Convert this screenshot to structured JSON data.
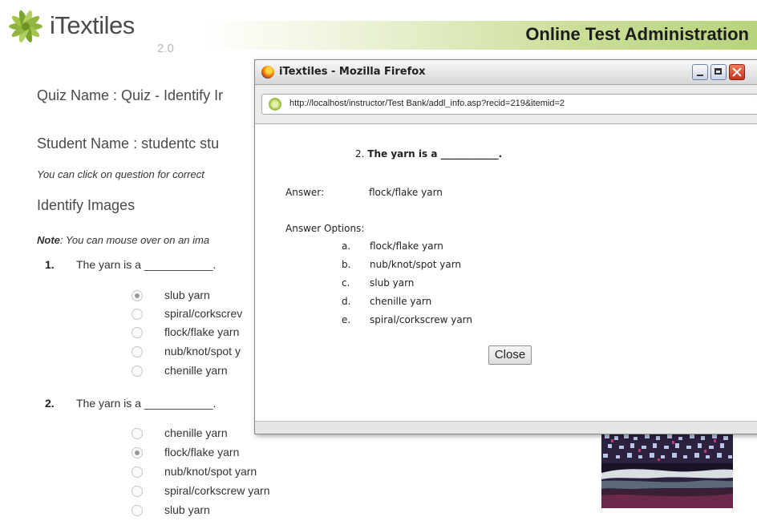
{
  "header": {
    "logo_text": "iTextiles",
    "logo_version": "2.0",
    "title": "Online Test Administration"
  },
  "quiz": {
    "name_line": "Quiz Name : Quiz - Identify Ir",
    "student_line": "Student Name : studentc stu",
    "hint": "You can click on question for correct",
    "section_title": "Identify Images",
    "note_label": "Note",
    "note_text": ": You can mouse over on an ima",
    "questions": [
      {
        "number": "1.",
        "text": "The yarn is a ___________.",
        "options": [
          {
            "label": "slub yarn",
            "selected": true
          },
          {
            "label": "spiral/corkscrev",
            "selected": false
          },
          {
            "label": "flock/flake yarn",
            "selected": false
          },
          {
            "label": "nub/knot/spot y",
            "selected": false
          },
          {
            "label": "chenille yarn",
            "selected": false
          }
        ]
      },
      {
        "number": "2.",
        "text": "The yarn is a ___________.",
        "options": [
          {
            "label": "chenille yarn",
            "selected": false
          },
          {
            "label": "flock/flake yarn",
            "selected": true
          },
          {
            "label": "nub/knot/spot yarn",
            "selected": false
          },
          {
            "label": "spiral/corkscrew yarn",
            "selected": false
          },
          {
            "label": "slub yarn",
            "selected": false
          }
        ]
      }
    ]
  },
  "popup": {
    "window_title": "iTextiles - Mozilla Firefox",
    "url": "http://localhost/instructor/Test Bank/addl_info.asp?recid=219&itemid=2",
    "question_number": "2.",
    "question_text": "The yarn is a ____________.",
    "answer_label": "Answer:",
    "answer_value": "flock/flake yarn",
    "options_label": "Answer Options:",
    "options": [
      {
        "letter": "a.",
        "text": "flock/flake yarn"
      },
      {
        "letter": "b.",
        "text": "nub/knot/spot yarn"
      },
      {
        "letter": "c.",
        "text": "slub yarn"
      },
      {
        "letter": "d.",
        "text": "chenille yarn"
      },
      {
        "letter": "e.",
        "text": "spiral/corkscrew yarn"
      }
    ],
    "close_label": "Close"
  }
}
